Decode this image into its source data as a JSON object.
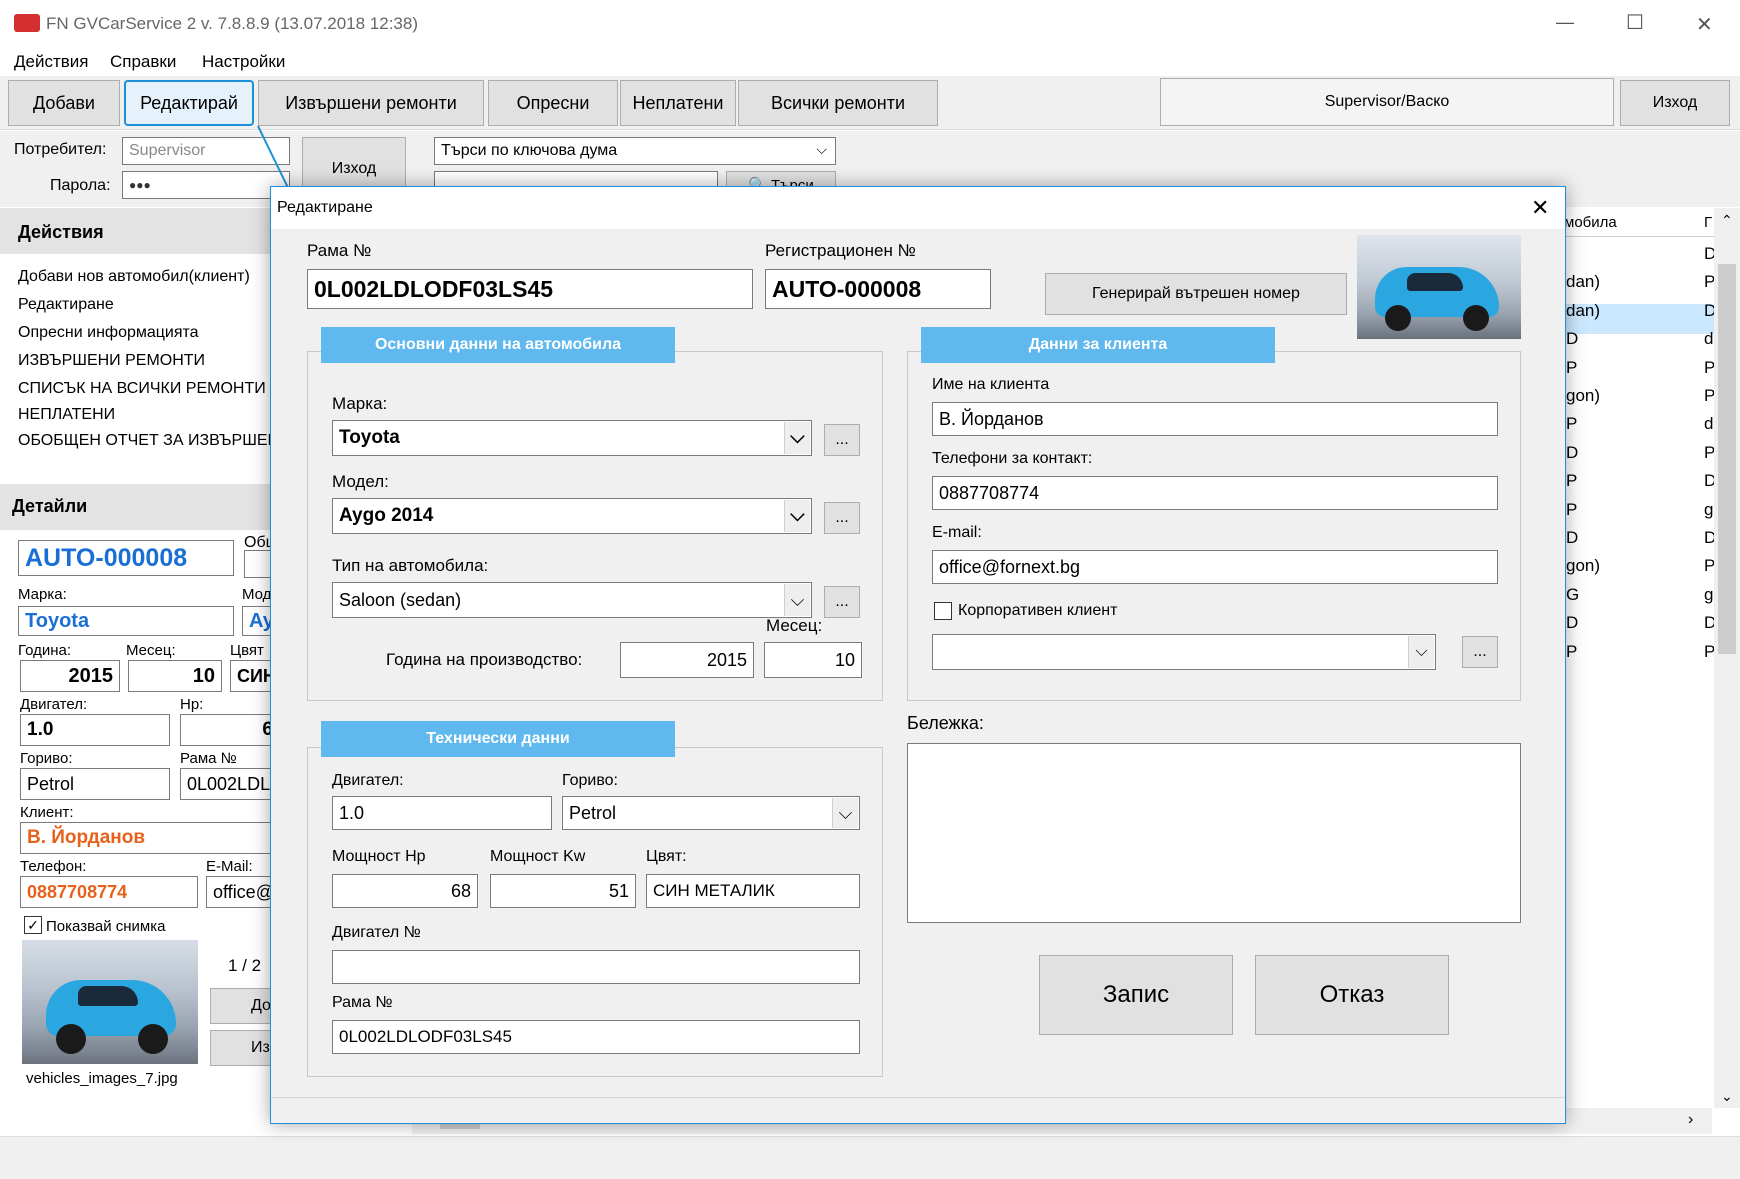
{
  "window": {
    "title": "FN GVCarService 2 v. 7.8.8.9 (13.07.2018 12:38)",
    "min": "—",
    "max": "☐",
    "close": "✕"
  },
  "menu": [
    "Действия",
    "Справки",
    "Настройки"
  ],
  "toolbar": {
    "add": "Добави",
    "edit": "Редактирай",
    "done": "Извършени ремонти",
    "refresh": "Опресни",
    "unpaid": "Неплатени",
    "all": "Всички ремонти",
    "user_display": "Supervisor/Васко",
    "exit": "Изход"
  },
  "login": {
    "user_label": "Потребител:",
    "user_value": "Supervisor",
    "pass_label": "Парола:",
    "pass_value": "●●●",
    "exit": "Изход"
  },
  "search": {
    "mode": "Търси по ключова дума",
    "button": "Търси"
  },
  "actions_panel": {
    "title": "Действия",
    "items": [
      "Добави нов автомобил(клиент)",
      "Редактиране",
      "Опресни информацията",
      "ИЗВЪРШЕНИ РЕМОНТИ",
      "СПИСЪК НА ВСИЧКИ РЕМОНТИ",
      "НЕПЛАТЕНИ",
      "ОБОБЩЕН ОТЧЕТ ЗА ИЗВЪРШЕНИ"
    ]
  },
  "details_panel": {
    "title": "Детайли",
    "reg": "AUTO-000008",
    "obsht": "Общ",
    "make_label": "Марка:",
    "make": "Toyota",
    "model_label": "Мод",
    "model": "Ay",
    "year_label": "Година:",
    "year": "2015",
    "month_label": "Месец:",
    "month": "10",
    "color_label": "Цвят",
    "color": "СИН",
    "engine_label": "Двигател:",
    "engine": "1.0",
    "hp_label": "Hp:",
    "hp": "6",
    "fuel_label": "Гориво:",
    "fuel": "Petrol",
    "vin_label": "Рама №",
    "vin": "0L002LDL",
    "client_label": "Клиент:",
    "client": "В. Йорданов",
    "phone_label": "Телефон:",
    "phone": "0887708774",
    "email_label": "E-Mail:",
    "email": "office@",
    "show_photo": "Показвай снимка",
    "counter": "1 / 2",
    "btn1": "До",
    "btn2": "Из",
    "filename": "vehicles_images_7.jpg"
  },
  "grid": {
    "header": [
      "мобила",
      "Г"
    ],
    "cells": [
      "",
      "D",
      "dan)",
      "P",
      "dan)",
      "D",
      "D",
      "dan)",
      "P",
      "P",
      "gon)",
      "P",
      "P",
      "dan)",
      "D",
      "P",
      "P",
      "D",
      "P",
      "gon)",
      "D",
      "D",
      "gon)",
      "P",
      "G",
      "gon)",
      "D",
      "D",
      "P",
      "P"
    ]
  },
  "dialog": {
    "title": "Редактиране",
    "vin_label": "Рама №",
    "vin": "0L002LDLODF03LS45",
    "reg_label": "Регистрационен №",
    "reg": "AUTO-000008",
    "generate": "Генерирай вътрешен номер",
    "car_section": "Основни данни на автомобила",
    "make_label": "Марка:",
    "make": "Toyota",
    "model_label": "Модел:",
    "model": "Aygo 2014",
    "type_label": "Тип на автомобила:",
    "type": "Saloon (sedan)",
    "year_label": "Година на производство:",
    "year": "2015",
    "month_label": "Месец:",
    "month": "10",
    "client_section": "Данни за клиента",
    "name_label": "Име на клиента",
    "name": "В. Йорданов",
    "phone_label": "Телефони за контакт:",
    "phone": "0887708774",
    "email_label": "E-mail:",
    "email": "office@fornext.bg",
    "corporate": "Корпоративен клиент",
    "tech_section": "Технически данни",
    "engine_label": "Двигател:",
    "engine": "1.0",
    "fuel_label": "Гориво:",
    "fuel": "Petrol",
    "hp_label": "Мощност Hp",
    "hp": "68",
    "kw_label": "Мощност Kw",
    "kw": "51",
    "color_label": "Цвят:",
    "color": "СИН МЕТАЛИК",
    "engine_no_label": "Двигател №",
    "engine_no": "",
    "vin2_label": "Рама №",
    "vin2": "0L002LDLODF03LS45",
    "note_label": "Бележка:",
    "save": "Запис",
    "cancel": "Отказ",
    "ellipsis": "..."
  },
  "colors": {
    "accent": "#5fb8ee",
    "highlight": "#cce8ff",
    "blue_text": "#1a6fd6",
    "orange_text": "#e8611a",
    "focus": "#1e90d8"
  }
}
